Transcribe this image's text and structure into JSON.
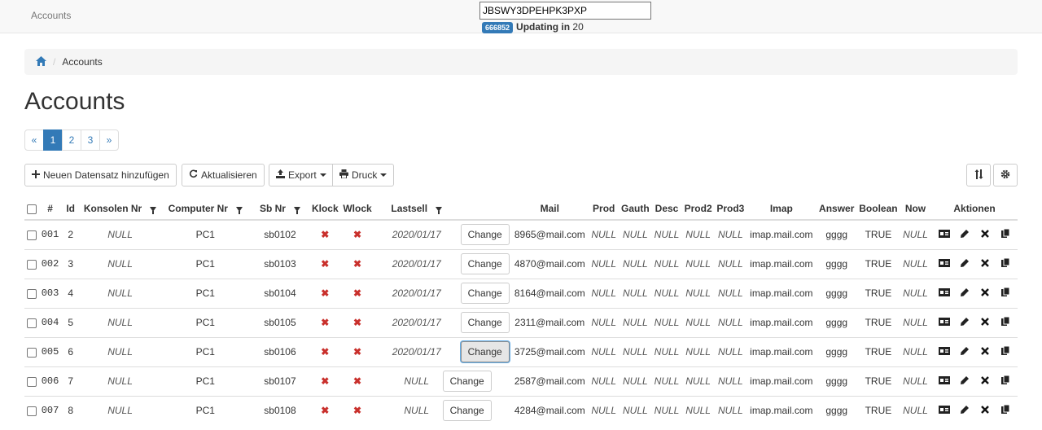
{
  "header": {
    "brand": "Accounts",
    "token_value": "JBSWY3DPEHPK3PXP",
    "code_badge": "666852",
    "updating_label": "Updating in",
    "updating_seconds": "20"
  },
  "breadcrumb": {
    "home_icon": "home-icon",
    "current": "Accounts"
  },
  "page_title": "Accounts",
  "pagination": {
    "prev": "«",
    "pages": [
      "1",
      "2",
      "3"
    ],
    "active_page": "1",
    "next": "»"
  },
  "toolbar": {
    "add_label": "Neuen Datensatz hinzufügen",
    "refresh_label": "Aktualisieren",
    "export_label": "Export",
    "print_label": "Druck",
    "sort_icon": "sort-icon",
    "settings_icon": "gear-icon"
  },
  "table": {
    "headers": [
      "#",
      "Id",
      "Konsolen Nr",
      "Computer Nr",
      "Sb Nr",
      "Klock",
      "Wlock",
      "Lastsell",
      "Mail",
      "Prod",
      "Gauth",
      "Desc",
      "Prod2",
      "Prod3",
      "Imap",
      "Answer",
      "Boolean",
      "Now",
      "Aktionen"
    ],
    "change_label": "Change",
    "rows": [
      {
        "num": "001",
        "id": "2",
        "konsolen": "NULL",
        "computer": "PC1",
        "sb": "sb0102",
        "lastsell": "2020/01/17",
        "mail": "8965@mail.com",
        "prod": "NULL",
        "gauth": "NULL",
        "desc": "NULL",
        "prod2": "NULL",
        "prod3": "NULL",
        "imap": "imap.mail.com",
        "answer": "gggg",
        "boolean": "TRUE",
        "now": "NULL"
      },
      {
        "num": "002",
        "id": "3",
        "konsolen": "NULL",
        "computer": "PC1",
        "sb": "sb0103",
        "lastsell": "2020/01/17",
        "mail": "4870@mail.com",
        "prod": "NULL",
        "gauth": "NULL",
        "desc": "NULL",
        "prod2": "NULL",
        "prod3": "NULL",
        "imap": "imap.mail.com",
        "answer": "gggg",
        "boolean": "TRUE",
        "now": "NULL"
      },
      {
        "num": "003",
        "id": "4",
        "konsolen": "NULL",
        "computer": "PC1",
        "sb": "sb0104",
        "lastsell": "2020/01/17",
        "mail": "8164@mail.com",
        "prod": "NULL",
        "gauth": "NULL",
        "desc": "NULL",
        "prod2": "NULL",
        "prod3": "NULL",
        "imap": "imap.mail.com",
        "answer": "gggg",
        "boolean": "TRUE",
        "now": "NULL"
      },
      {
        "num": "004",
        "id": "5",
        "konsolen": "NULL",
        "computer": "PC1",
        "sb": "sb0105",
        "lastsell": "2020/01/17",
        "mail": "2311@mail.com",
        "prod": "NULL",
        "gauth": "NULL",
        "desc": "NULL",
        "prod2": "NULL",
        "prod3": "NULL",
        "imap": "imap.mail.com",
        "answer": "gggg",
        "boolean": "TRUE",
        "now": "NULL"
      },
      {
        "num": "005",
        "id": "6",
        "konsolen": "NULL",
        "computer": "PC1",
        "sb": "sb0106",
        "lastsell": "2020/01/17",
        "mail": "3725@mail.com",
        "prod": "NULL",
        "gauth": "NULL",
        "desc": "NULL",
        "prod2": "NULL",
        "prod3": "NULL",
        "imap": "imap.mail.com",
        "answer": "gggg",
        "boolean": "TRUE",
        "now": "NULL",
        "change_focused": true
      },
      {
        "num": "006",
        "id": "7",
        "konsolen": "NULL",
        "computer": "PC1",
        "sb": "sb0107",
        "lastsell": "NULL",
        "mail": "2587@mail.com",
        "prod": "NULL",
        "gauth": "NULL",
        "desc": "NULL",
        "prod2": "NULL",
        "prod3": "NULL",
        "imap": "imap.mail.com",
        "answer": "gggg",
        "boolean": "TRUE",
        "now": "NULL"
      },
      {
        "num": "007",
        "id": "8",
        "konsolen": "NULL",
        "computer": "PC1",
        "sb": "sb0108",
        "lastsell": "NULL",
        "mail": "4284@mail.com",
        "prod": "NULL",
        "gauth": "NULL",
        "desc": "NULL",
        "prod2": "NULL",
        "prod3": "NULL",
        "imap": "imap.mail.com",
        "answer": "gggg",
        "boolean": "TRUE",
        "now": "NULL"
      }
    ]
  },
  "colors": {
    "primary": "#337ab7",
    "lock_x": "#c9302c"
  }
}
